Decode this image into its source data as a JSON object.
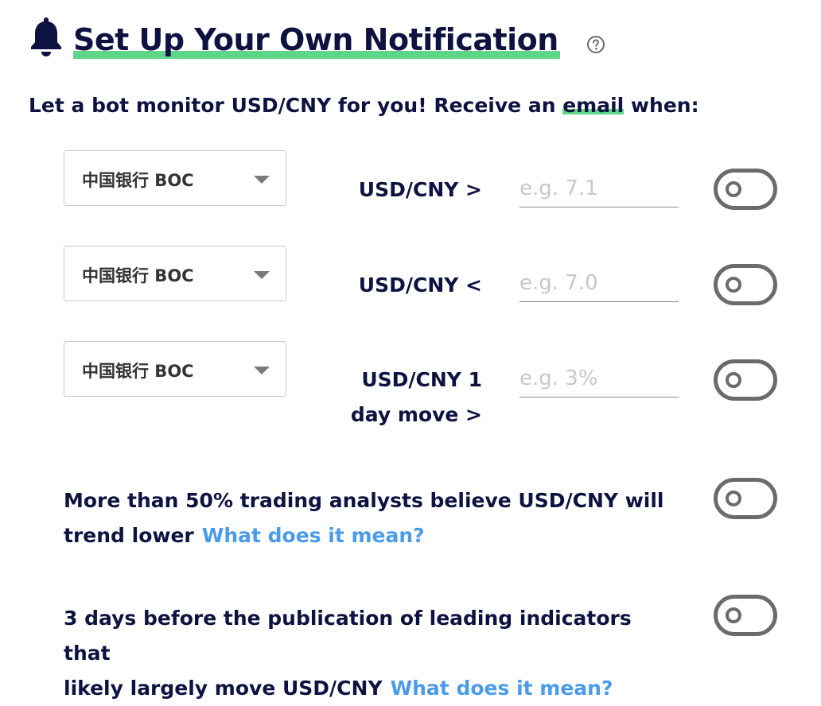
{
  "header": {
    "title": "Set Up Your Own Notification",
    "icon": "bell-icon",
    "help_icon": "question-circle-icon",
    "accent_color": "#5ed68a"
  },
  "subtitle": {
    "before": "Let a bot monitor USD/CNY for you! Receive an ",
    "email": "email",
    "after": " when:"
  },
  "rate_alerts": [
    {
      "bank": "中国银行 BOC",
      "label": "USD/CNY >",
      "placeholder": "e.g. 7.1",
      "value": "",
      "enabled": false
    },
    {
      "bank": "中国银行 BOC",
      "label": "USD/CNY <",
      "placeholder": "e.g. 7.0",
      "value": "",
      "enabled": false
    },
    {
      "bank": "中国银行 BOC",
      "label_line1": "USD/CNY 1",
      "label_line2": "day move >",
      "placeholder": "e.g. 3%",
      "value": "",
      "enabled": false
    }
  ],
  "other_alerts": [
    {
      "line1": "More than 50% trading analysts believe USD/CNY will",
      "line2": "trend lower",
      "link": "What does it mean?",
      "enabled": false
    },
    {
      "line1": "3 days before the publication of leading indicators that",
      "line2": "likely largely move USD/CNY",
      "link": "What does it mean?",
      "enabled": false
    }
  ],
  "link_color": "#4a9be8"
}
